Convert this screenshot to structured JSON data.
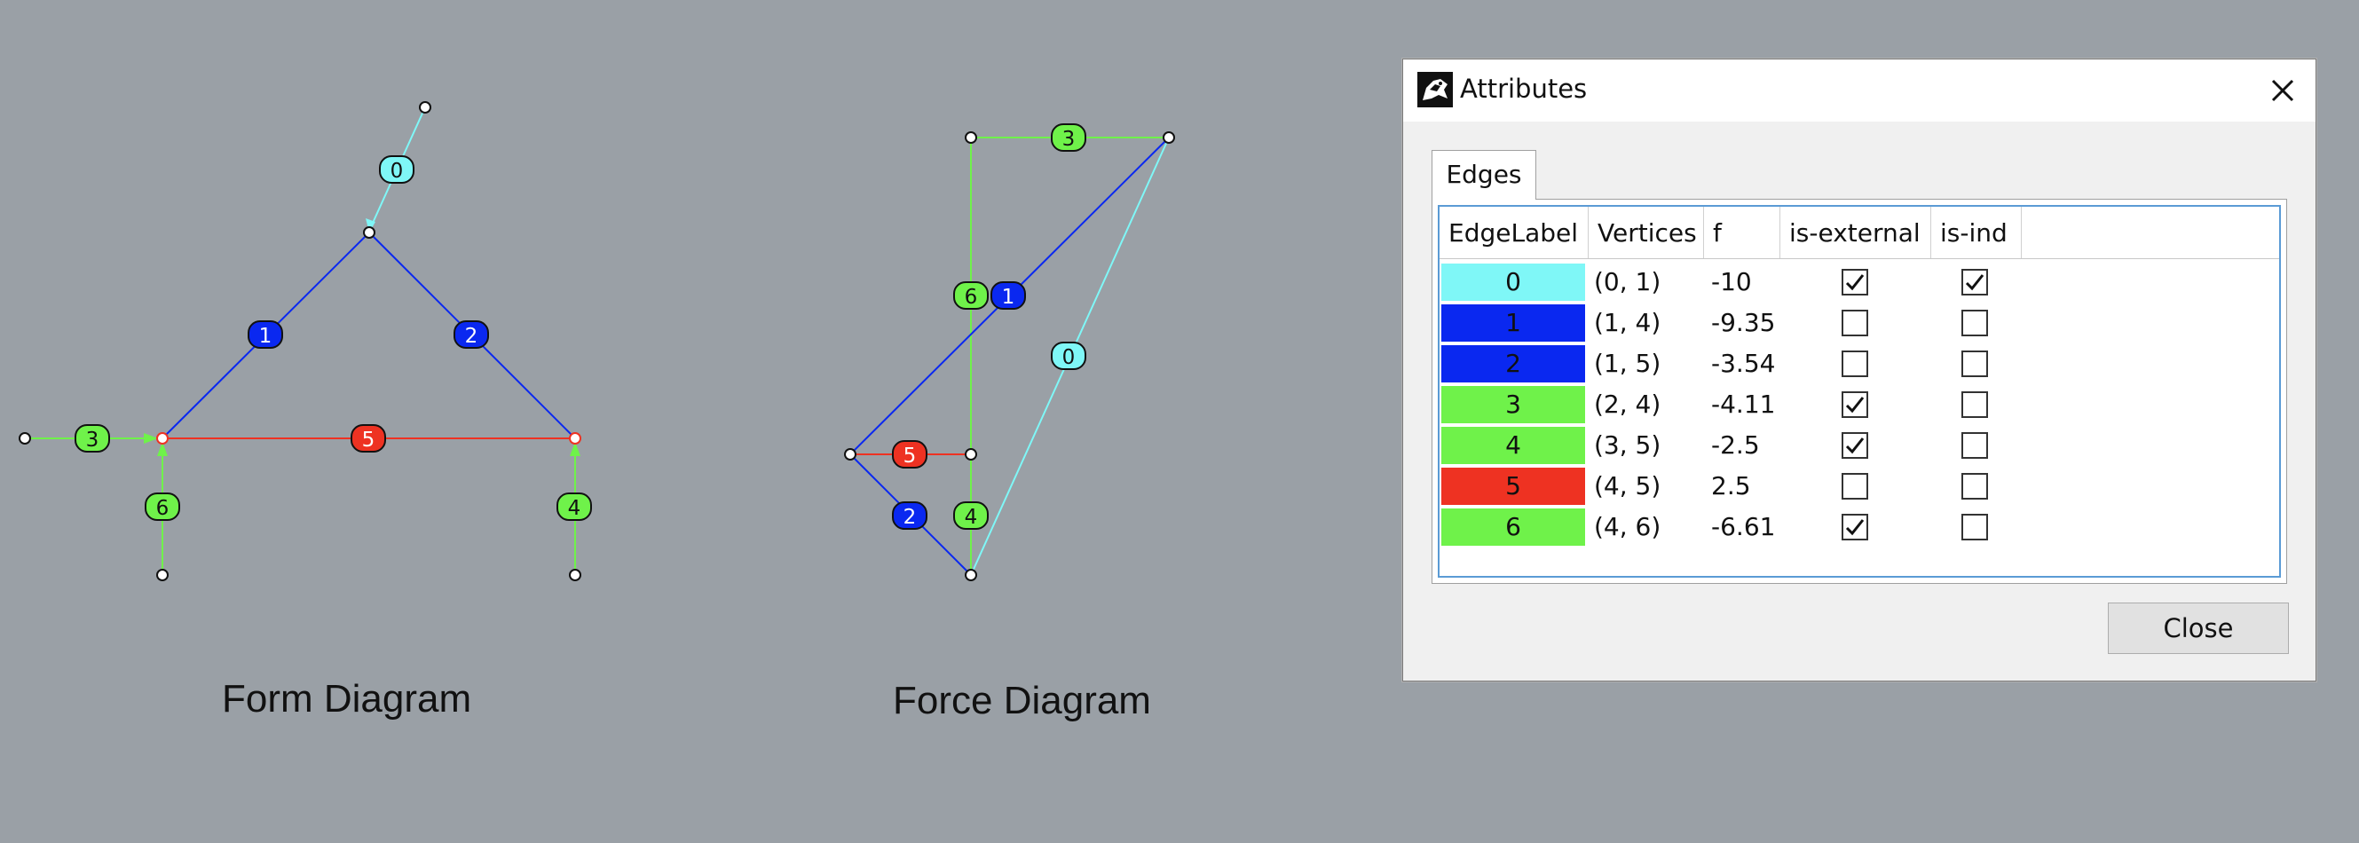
{
  "form_diagram": {
    "caption": "Form Diagram",
    "edge_labels": [
      "0",
      "1",
      "2",
      "3",
      "4",
      "5",
      "6"
    ]
  },
  "force_diagram": {
    "caption": "Force Diagram",
    "edge_labels": [
      "0",
      "1",
      "2",
      "3",
      "4",
      "5",
      "6"
    ]
  },
  "dialog": {
    "title": "Attributes",
    "tab": "Edges",
    "columns": [
      "EdgeLabel",
      "Vertices",
      "f",
      "is-external",
      "is-ind"
    ],
    "rows": [
      {
        "label": "0",
        "color": "#7ff7f7",
        "vertices": "(0, 1)",
        "f": "-10",
        "is_external": true,
        "is_ind": true
      },
      {
        "label": "1",
        "color": "#0a28f0",
        "vertices": "(1, 4)",
        "f": "-9.35",
        "is_external": false,
        "is_ind": false
      },
      {
        "label": "2",
        "color": "#0a28f0",
        "vertices": "(1, 5)",
        "f": "-3.54",
        "is_external": false,
        "is_ind": false
      },
      {
        "label": "3",
        "color": "#6ff24a",
        "vertices": "(2, 4)",
        "f": "-4.11",
        "is_external": true,
        "is_ind": false
      },
      {
        "label": "4",
        "color": "#6ff24a",
        "vertices": "(3, 5)",
        "f": "-2.5",
        "is_external": true,
        "is_ind": false
      },
      {
        "label": "5",
        "color": "#ee3222",
        "vertices": "(4, 5)",
        "f": "2.5",
        "is_external": false,
        "is_ind": false
      },
      {
        "label": "6",
        "color": "#6ff24a",
        "vertices": "(4, 6)",
        "f": "-6.61",
        "is_external": true,
        "is_ind": false
      }
    ],
    "close_button": "Close"
  },
  "colors": {
    "background": "#9aa0a6",
    "cyan": "#7ff7f7",
    "blue": "#0a28f0",
    "green": "#6ff24a",
    "red": "#ee3222"
  }
}
